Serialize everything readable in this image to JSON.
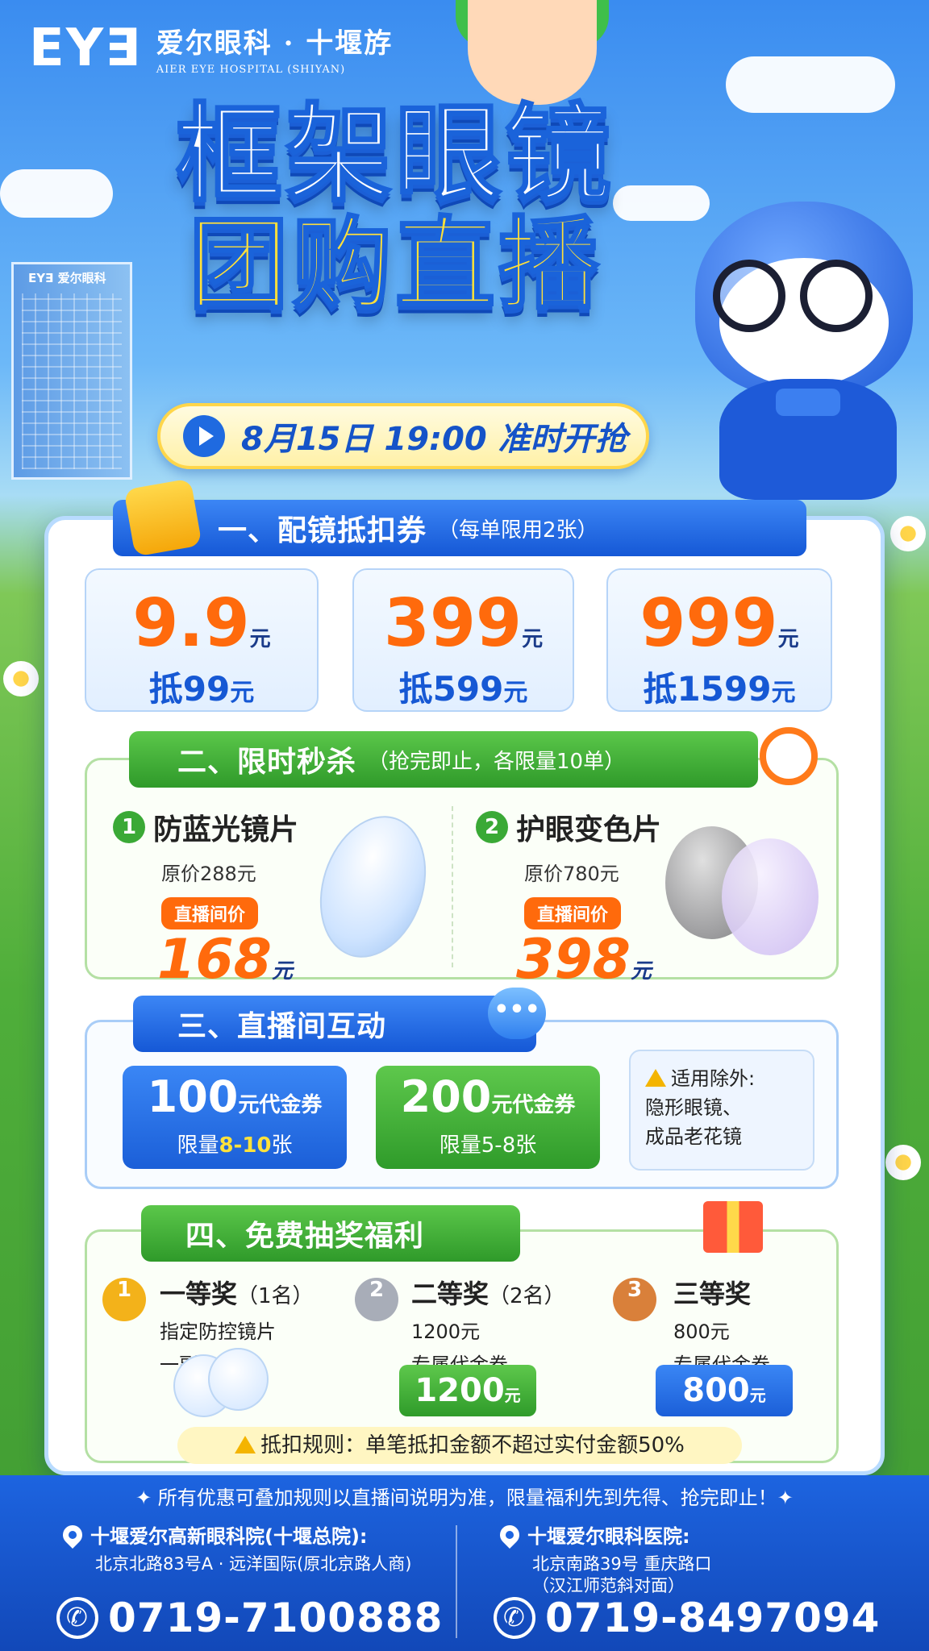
{
  "header": {
    "logo_mark": "EY∃",
    "hospital_cn": "爱尔眼科 · 十堰斿",
    "hospital_en": "AIER EYE HOSPITAL (SHIYAN)",
    "title_line1": "框架眼镜",
    "title_line2": "团购直播",
    "date_text": "8月15日 19:00 准时开抢",
    "building_sign": "EY∃ 爱尔眼科"
  },
  "section1": {
    "title": "一、配镜抵扣券",
    "note": "（每单限用2张）",
    "coupons": [
      {
        "price": "9.9",
        "unit": "元",
        "deduct_prefix": "抵",
        "deduct_value": "99",
        "deduct_unit": "元"
      },
      {
        "price": "399",
        "unit": "元",
        "deduct_prefix": "抵",
        "deduct_value": "599",
        "deduct_unit": "元"
      },
      {
        "price": "999",
        "unit": "元",
        "deduct_prefix": "抵",
        "deduct_value": "1599",
        "deduct_unit": "元"
      }
    ]
  },
  "section2": {
    "title": "二、限时秒杀",
    "note": "（抢完即止，各限量10单）",
    "items": [
      {
        "num": "1",
        "name": "防蓝光镜片",
        "original": "原价288元",
        "tag": "直播间价",
        "price": "168",
        "unit": "元"
      },
      {
        "num": "2",
        "name": "护眼变色片",
        "original": "原价780元",
        "tag": "直播间价",
        "price": "398",
        "unit": "元"
      }
    ]
  },
  "section3": {
    "title": "三、直播间互动",
    "vouchers": [
      {
        "amount": "100",
        "unit": "元代金券",
        "limit_prefix": "限量",
        "limit_value": "8-10",
        "limit_suffix": "张"
      },
      {
        "amount": "200",
        "unit": "元代金券",
        "limit_prefix": "限量",
        "limit_value": "5-8",
        "limit_suffix": "张"
      }
    ],
    "exception_title": "适用除外:",
    "exception_line1": "隐形眼镜、",
    "exception_line2": "成品老花镜"
  },
  "section4": {
    "title": "四、免费抽奖福利",
    "prizes": [
      {
        "medal": "1",
        "name": "一等奖",
        "count": "（1名）",
        "line1": "指定防控镜片",
        "line2": "一副"
      },
      {
        "medal": "2",
        "name": "二等奖",
        "count": "（2名）",
        "line1": "1200元",
        "line2": "专属代金券",
        "btn_value": "1200",
        "btn_unit": "元"
      },
      {
        "medal": "3",
        "name": "三等奖",
        "count": "",
        "line1": "800元",
        "line2": "专属代金券",
        "btn_value": "800",
        "btn_unit": "元"
      }
    ],
    "rule": "抵扣规则：单笔抵扣金额不超过实付金额50%"
  },
  "footer": {
    "note": "✦ 所有优惠可叠加规则以直播间说明为准，限量福利先到先得、抢完即止！✦",
    "clinic1": {
      "name": "十堰爱尔高新眼科院(十堰总院):",
      "addr1": "北京北路83号A · 远洋国际(原北京路人商)",
      "addr2": "",
      "phone": "0719-7100888"
    },
    "clinic2": {
      "name": "十堰爱尔眼科医院:",
      "addr1": "北京南路39号 重庆路口",
      "addr2": "（汉江师范斜对面）",
      "phone": "0719-8497094"
    }
  },
  "colors": {
    "brand_blue": "#1b5fd8",
    "accent_orange": "#ff6a0c",
    "accent_green": "#3aa936",
    "accent_yellow": "#ffe03a"
  }
}
